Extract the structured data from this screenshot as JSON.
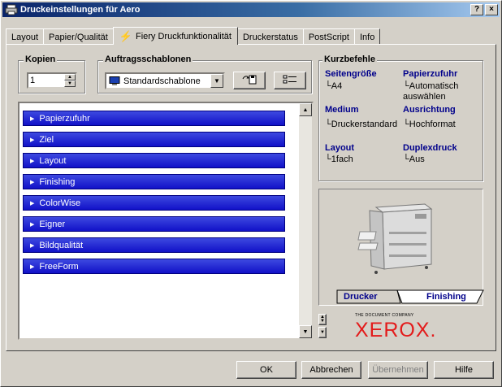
{
  "window": {
    "title": "Druckeinstellungen für Aero",
    "help": "?",
    "close": "×"
  },
  "tabs": [
    {
      "label": "Layout"
    },
    {
      "label": "Papier/Qualität"
    },
    {
      "label": "Fiery Druckfunktionalität"
    },
    {
      "label": "Druckerstatus"
    },
    {
      "label": "PostScript"
    },
    {
      "label": "Info"
    }
  ],
  "copies": {
    "label": "Kopien",
    "value": "1"
  },
  "templates": {
    "label": "Auftragsschablonen",
    "selected": "Standardschablone"
  },
  "sections": [
    "Papierzufuhr",
    "Ziel",
    "Layout",
    "Finishing",
    "ColorWise",
    "Eigner",
    "Bildqualität",
    "FreeForm"
  ],
  "shortcuts": {
    "label": "Kurzbefehle",
    "items": [
      {
        "heading": "Seitengröße",
        "value": "A4"
      },
      {
        "heading": "Papierzufuhr",
        "value": "Automatisch auswählen"
      },
      {
        "heading": "Medium",
        "value": "Druckerstandard"
      },
      {
        "heading": "Ausrichtung",
        "value": "Hochformat"
      },
      {
        "heading": "Layout",
        "value": "1fach"
      },
      {
        "heading": "Duplexdruck",
        "value": "Aus"
      }
    ]
  },
  "preview": {
    "tab_printer": "Drucker",
    "tab_finishing": "Finishing"
  },
  "brand": {
    "tagline": "THE DOCUMENT COMPANY",
    "name": "XEROX."
  },
  "footer": {
    "ok": "OK",
    "cancel": "Abbrechen",
    "apply": "Übernehmen",
    "help": "Hilfe"
  },
  "colors": {
    "accent": "#1515cc",
    "brand_red": "#e31b1b",
    "heading": "#00008b"
  }
}
